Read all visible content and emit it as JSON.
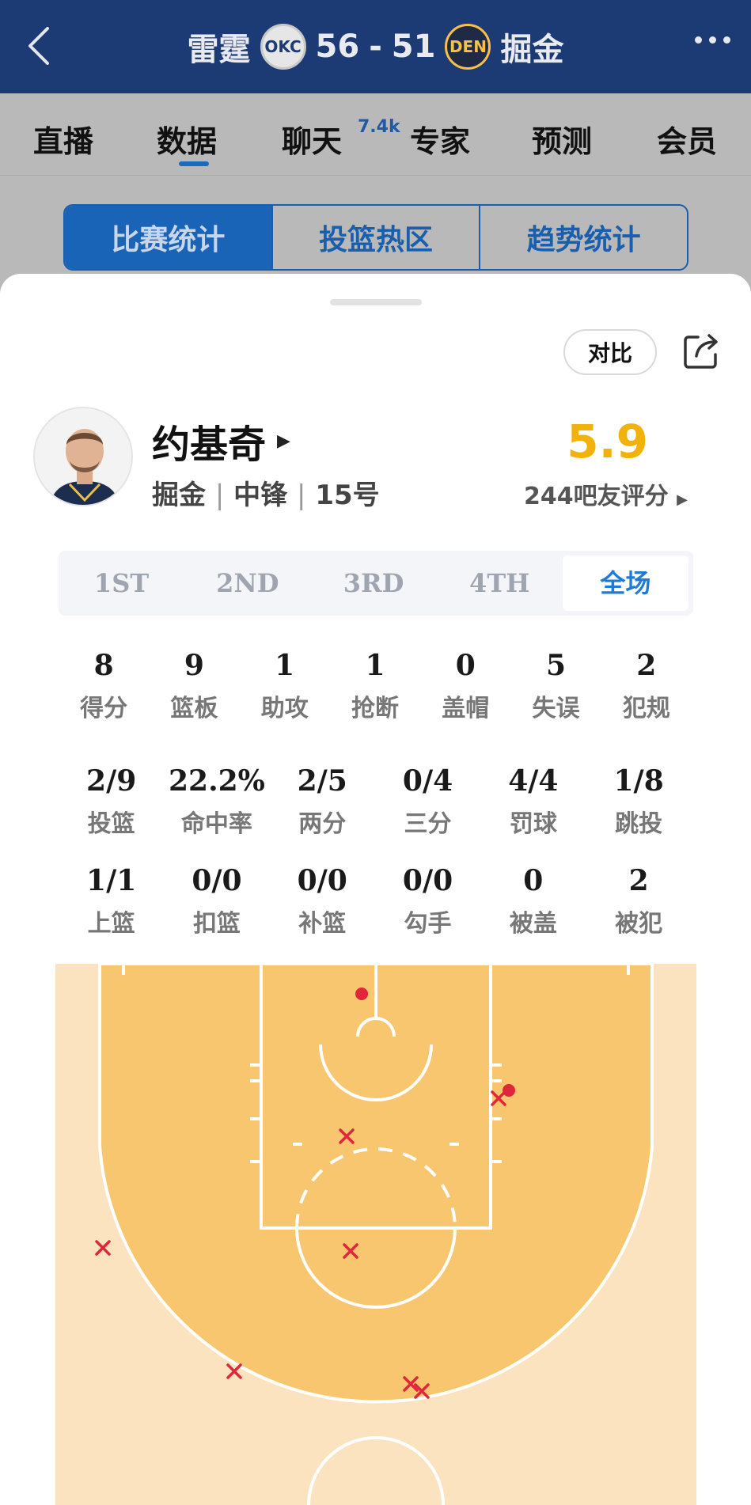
{
  "header": {
    "home_team": "雷霆",
    "home_abbr": "OKC",
    "home_score": "56",
    "separator": "-",
    "away_score": "51",
    "away_abbr": "DEN",
    "away_team": "掘金"
  },
  "tabs": [
    {
      "label": "直播"
    },
    {
      "label": "数据"
    },
    {
      "label": "聊天"
    },
    {
      "label": "专家"
    },
    {
      "label": "预测"
    },
    {
      "label": "会员"
    }
  ],
  "chat_count": "7.4k",
  "segments": [
    "比赛统计",
    "投篮热区",
    "趋势统计"
  ],
  "compare_label": "对比",
  "player": {
    "name": "约基奇",
    "team": "掘金",
    "position": "中锋",
    "number": "15号",
    "meta_sep": "|",
    "rating": "5.9",
    "rating_sub": "244吧友评分"
  },
  "periods": [
    "1ST",
    "2ND",
    "3RD",
    "4TH",
    "全场"
  ],
  "stats_row1": [
    {
      "value": "8",
      "label": "得分"
    },
    {
      "value": "9",
      "label": "篮板"
    },
    {
      "value": "1",
      "label": "助攻"
    },
    {
      "value": "1",
      "label": "抢断"
    },
    {
      "value": "0",
      "label": "盖帽"
    },
    {
      "value": "5",
      "label": "失误"
    },
    {
      "value": "2",
      "label": "犯规"
    }
  ],
  "stats_row2": [
    {
      "value": "2/9",
      "label": "投篮"
    },
    {
      "value": "22.2%",
      "label": "命中率"
    },
    {
      "value": "2/5",
      "label": "两分"
    },
    {
      "value": "0/4",
      "label": "三分"
    },
    {
      "value": "4/4",
      "label": "罚球"
    },
    {
      "value": "1/8",
      "label": "跳投"
    }
  ],
  "stats_row3": [
    {
      "value": "1/1",
      "label": "上篮"
    },
    {
      "value": "0/0",
      "label": "扣篮"
    },
    {
      "value": "0/0",
      "label": "补篮"
    },
    {
      "value": "0/0",
      "label": "勾手"
    },
    {
      "value": "0",
      "label": "被盖"
    },
    {
      "value": "2",
      "label": "被犯"
    }
  ],
  "colors": {
    "header_bg": "#1c3a73",
    "accent_blue": "#1a64b8",
    "rating_gold": "#f2b20a",
    "court_outer": "#fbe3bf",
    "court_inner": "#f7c66e",
    "made_shot": "#e0263a",
    "missed_shot": "#e0263a"
  },
  "icons": {
    "back": "chevron-left-icon",
    "more": "more-horizontal-icon",
    "share": "share-icon",
    "player_arrow": "caret-right-icon"
  }
}
